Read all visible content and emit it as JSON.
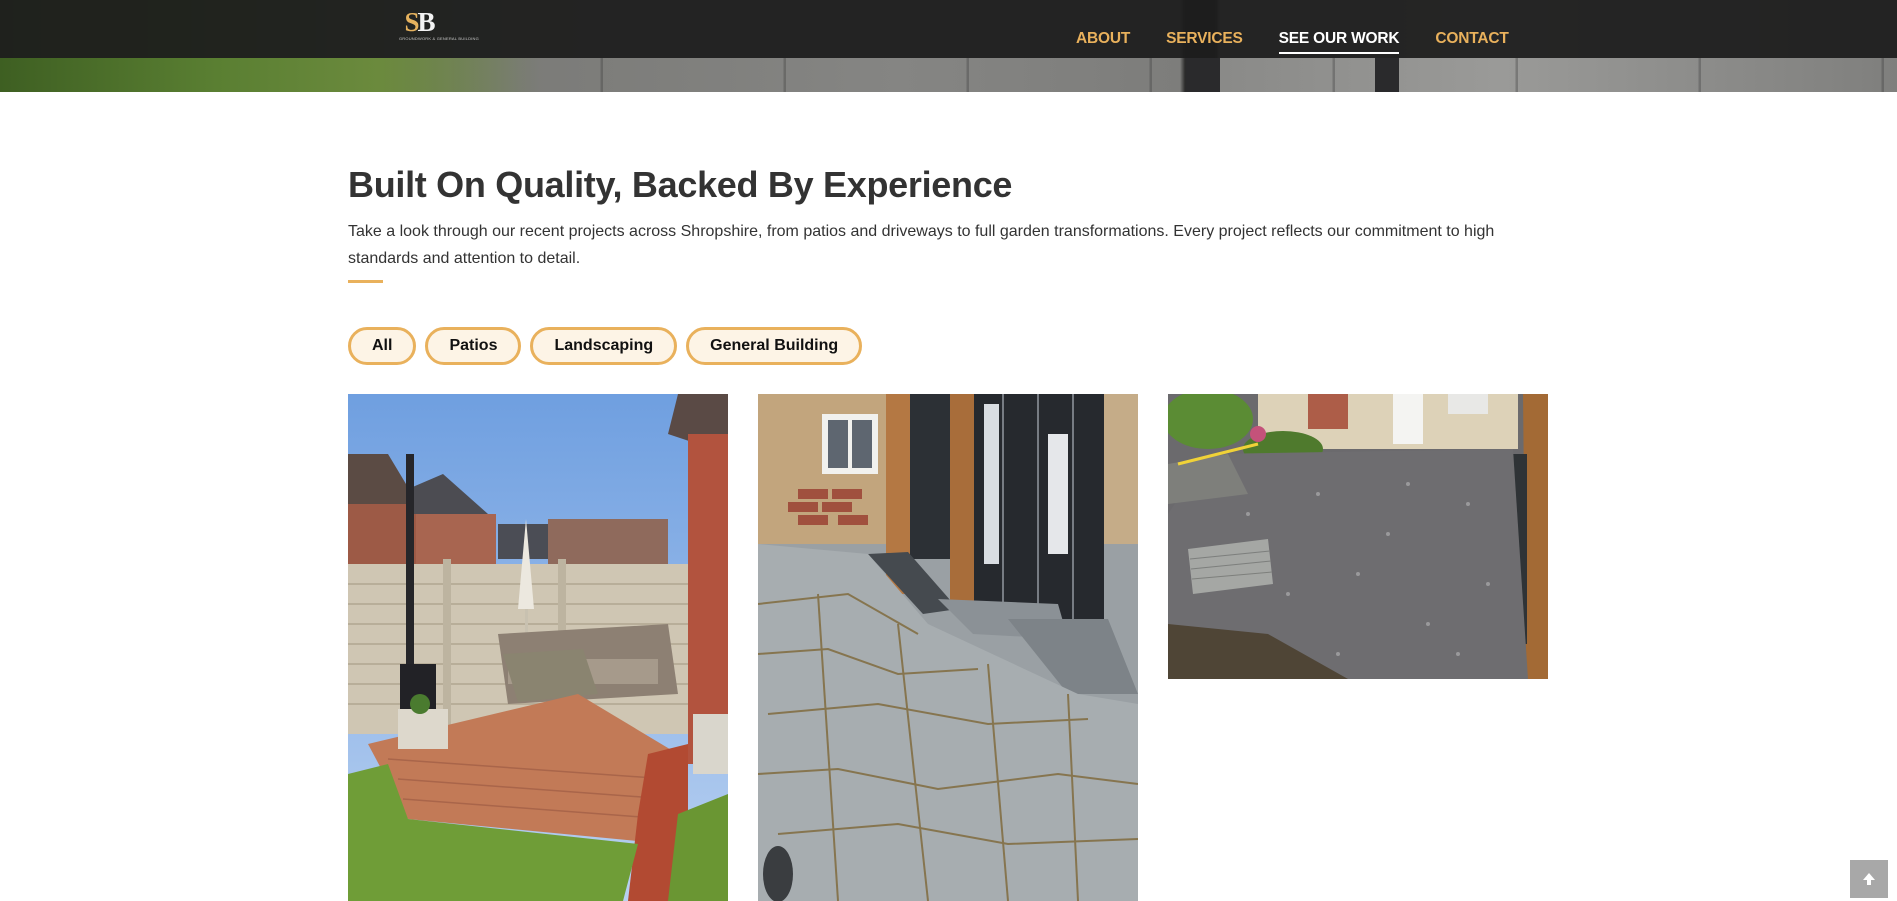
{
  "header": {
    "logo": {
      "monogram_s": "S",
      "monogram_b": "B",
      "tagline": "GROUNDWORK & GENERAL BUILDING"
    },
    "nav": [
      {
        "label": "ABOUT",
        "active": false
      },
      {
        "label": "SERVICES",
        "active": false
      },
      {
        "label": "SEE OUR WORK",
        "active": true
      },
      {
        "label": "CONTACT",
        "active": false
      }
    ]
  },
  "main": {
    "title": "Built On Quality, Backed By Experience",
    "intro": "Take a look through our recent projects across Shropshire, from patios and driveways to full garden transformations. Every project reflects our commitment to high standards and attention to detail.",
    "filters": [
      "All",
      "Patios",
      "Landscaping",
      "General Building"
    ],
    "gallery": [
      {
        "name": "gallery-image-garden-decking"
      },
      {
        "name": "gallery-image-stone-patio"
      },
      {
        "name": "gallery-image-gravel-base"
      }
    ]
  },
  "back_to_top": {
    "icon": "arrow-up-icon"
  },
  "colors": {
    "accent": "#e9b15c",
    "nav_bar": "#1c1c1c",
    "heading": "#333333",
    "filter_bg": "#fdf4e6",
    "back_to_top_bg": "#a8a8a8"
  }
}
